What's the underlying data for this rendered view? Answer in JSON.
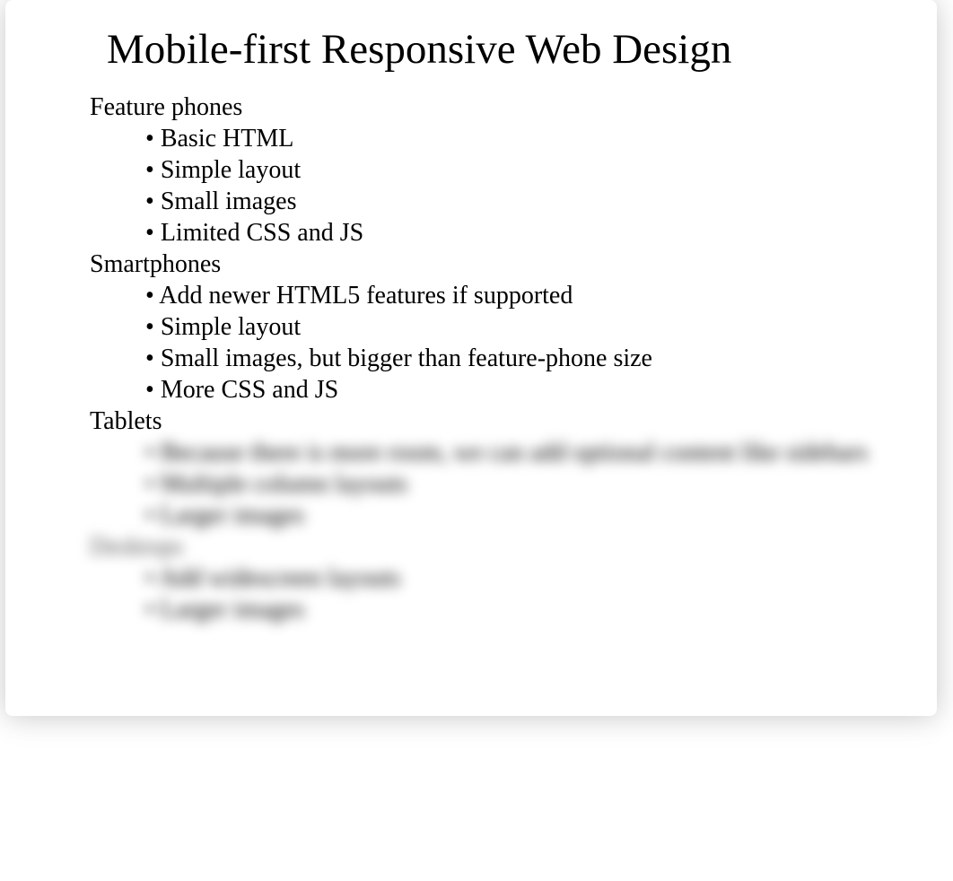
{
  "title": "Mobile-first Responsive Web Design",
  "sections": [
    {
      "heading": "Feature phones",
      "items": [
        "Basic HTML",
        "Simple layout",
        "Small images",
        "Limited CSS and JS"
      ],
      "blurred": false
    },
    {
      "heading": "Smartphones",
      "items": [
        "Add newer HTML5 features if supported",
        "Simple layout",
        "Small images, but bigger than feature-phone size",
        "More CSS and JS"
      ],
      "blurred": false
    },
    {
      "heading": "Tablets",
      "items": [
        "Because there is more room, we can add optional content like sidebars",
        "Multiple column layouts",
        "Larger images"
      ],
      "heading_blurred": false,
      "items_blurred": true
    },
    {
      "heading": "Desktops",
      "items": [
        "Add widescreen layouts",
        "Larger images"
      ],
      "heading_blurred": true,
      "items_blurred": true
    }
  ]
}
